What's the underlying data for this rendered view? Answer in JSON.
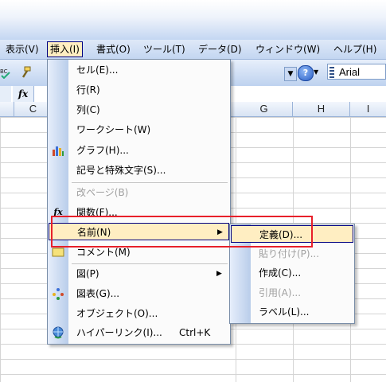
{
  "menubar": {
    "items": [
      {
        "label": "表示(V)",
        "key": "view"
      },
      {
        "label": "挿入(I)",
        "key": "insert"
      },
      {
        "label": "書式(O)",
        "key": "format"
      },
      {
        "label": "ツール(T)",
        "key": "tools"
      },
      {
        "label": "データ(D)",
        "key": "data"
      },
      {
        "label": "ウィンドウ(W)",
        "key": "window"
      },
      {
        "label": "ヘルプ(H)",
        "key": "help"
      }
    ]
  },
  "toolbar": {
    "font_name": "Arial",
    "help_label": "?"
  },
  "formula_bar": {
    "fx_label": "fx"
  },
  "columns": [
    "C",
    "G",
    "H",
    "I"
  ],
  "insert_menu": {
    "items": [
      {
        "label": "セル(E)...",
        "icon": "none"
      },
      {
        "label": "行(R)",
        "icon": "none"
      },
      {
        "label": "列(C)",
        "icon": "none"
      },
      {
        "label": "ワークシート(W)",
        "icon": "none"
      },
      {
        "label": "グラフ(H)...",
        "icon": "chart-icon"
      },
      {
        "label": "記号と特殊文字(S)...",
        "icon": "none"
      },
      {
        "label": "改ページ(B)",
        "icon": "none",
        "disabled": true
      },
      {
        "label": "関数(F)...",
        "icon": "function-icon"
      },
      {
        "label": "名前(N)",
        "icon": "none",
        "submenu": true,
        "highlighted": true
      },
      {
        "label": "コメント(M)",
        "icon": "comment-icon"
      },
      {
        "label": "図(P)",
        "icon": "none",
        "submenu": true
      },
      {
        "label": "図表(G)...",
        "icon": "diagram-icon"
      },
      {
        "label": "オブジェクト(O)...",
        "icon": "none"
      },
      {
        "label": "ハイパーリンク(I)...",
        "icon": "hyperlink-icon",
        "shortcut": "Ctrl+K"
      }
    ]
  },
  "name_submenu": {
    "items": [
      {
        "label": "定義(D)...",
        "highlighted": true
      },
      {
        "label": "貼り付け(P)...",
        "disabled": true
      },
      {
        "label": "作成(C)..."
      },
      {
        "label": "引用(A)...",
        "disabled": true
      },
      {
        "label": "ラベル(L)..."
      }
    ]
  },
  "colors": {
    "highlight_bg": "#ffeec2",
    "highlight_border": "#000080",
    "annotation_red": "#e8202a",
    "menubar_bg": "#c3d6f1"
  }
}
